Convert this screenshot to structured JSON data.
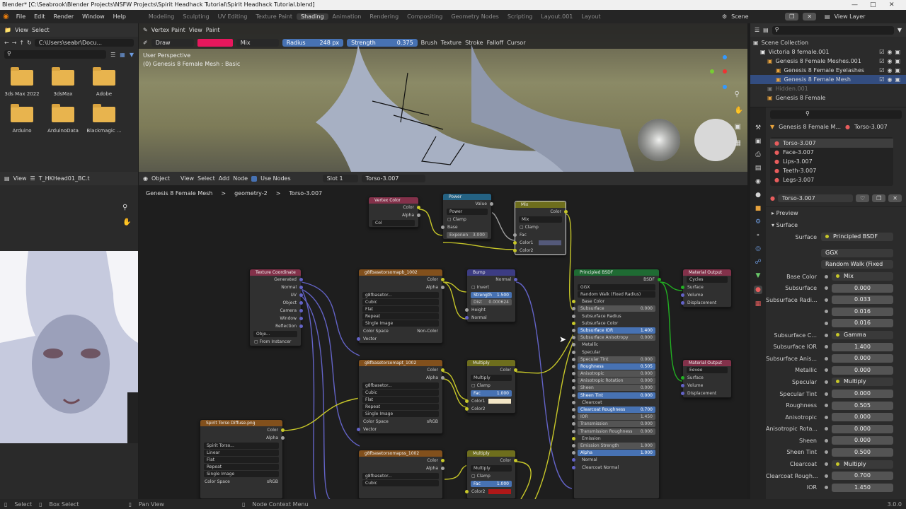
{
  "window": {
    "title": "Blender* [C:\\Seabrook\\Blender Projects\\NSFW Projects\\Spirit Headhack Tutorial\\Spirit Headhack Tutorial.blend]"
  },
  "menu": [
    "File",
    "Edit",
    "Render",
    "Window",
    "Help"
  ],
  "workspaces": [
    "Modeling",
    "Sculpting",
    "UV Editing",
    "Texture Paint",
    "Shading",
    "Animation",
    "Rendering",
    "Compositing",
    "Geometry Nodes",
    "Scripting",
    "Layout.001",
    "Layout"
  ],
  "active_workspace": "Shading",
  "scene": {
    "label": "Scene",
    "view_layer": "View Layer"
  },
  "file_browser": {
    "view": "View",
    "select": "Select",
    "path": "C:\\Users\\seabr\\Docu...",
    "folders": [
      "3ds Max 2022",
      "3dsMax",
      "Adobe",
      "Arduino",
      "ArduinoData",
      "Blackmagic ..."
    ]
  },
  "viewport": {
    "mode": "Vertex Paint",
    "view": "View",
    "paint": "Paint",
    "tool": "Draw",
    "blend": "Mix",
    "radius_label": "Radius",
    "radius_value": "248 px",
    "strength_label": "Strength",
    "strength_value": "0.375",
    "brush": "Brush",
    "texture": "Texture",
    "stroke": "Stroke",
    "falloff": "Falloff",
    "cursor": "Cursor",
    "overlay_line1": "User Perspective",
    "overlay_line2": "(0) Genesis 8 Female Mesh : Basic",
    "paint_color": "#e8175d"
  },
  "image_editor": {
    "view": "View",
    "image": "T_HKHead01_BC.t"
  },
  "node_editor": {
    "type": "Object",
    "view": "View",
    "select": "Select",
    "add": "Add",
    "node": "Node",
    "use_nodes": "Use Nodes",
    "slot": "Slot 1",
    "material": "Torso-3.007",
    "breadcrumb": [
      "Genesis 8 Female Mesh",
      "geometry-2",
      "Torso-3.007"
    ]
  },
  "nodes": {
    "vertex_color": {
      "title": "Vertex Color",
      "out1": "Color",
      "out2": "Alpha",
      "field": "Col"
    },
    "power": {
      "title": "Power",
      "out": "Value",
      "op": "Power",
      "clamp": "Clamp",
      "base": "Base",
      "exp_label": "Exponen",
      "exp_value": "3.000"
    },
    "mix": {
      "title": "Mix",
      "out": "Color",
      "op": "Mix",
      "clamp": "Clamp",
      "fac": "Fac",
      "c1": "Color1",
      "c2": "Color2"
    },
    "texcoord": {
      "title": "Texture Coordinate",
      "outs": [
        "Generated",
        "Normal",
        "UV",
        "Object",
        "Camera",
        "Window",
        "Reflection"
      ],
      "obj": "Obje...",
      "inst": "From Instancer"
    },
    "img1": {
      "title": "g8fbasetorsomapb_1002",
      "color": "Color",
      "alpha": "Alpha",
      "name": "g8fbasetor...",
      "interp": "Cubic",
      "proj": "Flat",
      "ext": "Repeat",
      "src": "Single Image",
      "cs_label": "Color Space",
      "cs_value": "Non-Color",
      "vec": "Vector"
    },
    "img2": {
      "title": "g8fbasetorsomapt_1002",
      "color": "Color",
      "alpha": "Alpha",
      "name": "g8fbasetor...",
      "interp": "Cubic",
      "proj": "Flat",
      "ext": "Repeat",
      "src": "Single Image",
      "cs_label": "Color Space",
      "cs_value": "sRGB",
      "vec": "Vector"
    },
    "img3": {
      "title": "g8fbasetorsomapss_1002",
      "color": "Color",
      "alpha": "Alpha",
      "name": "g8fbasetor...",
      "interp": "Cubic"
    },
    "img4": {
      "title": "Spirit Torso Diffuse.png",
      "color": "Color",
      "alpha": "Alpha",
      "name": "Spirit Torso...",
      "interp": "Linear",
      "proj": "Flat",
      "ext": "Repeat",
      "src": "Single Image",
      "cs_label": "Color Space",
      "cs_value": "sRGB"
    },
    "bump": {
      "title": "Bump",
      "out": "Normal",
      "invert": "Invert",
      "str_label": "Strength",
      "str_value": "1.500",
      "dist_label": "Dist",
      "dist_value": "0.000624",
      "height": "Height",
      "normal": "Normal"
    },
    "multiply1": {
      "title": "Multiply",
      "out": "Color",
      "op": "Multiply",
      "clamp": "Clamp",
      "fac_label": "Fac",
      "fac_value": "1.000",
      "c1": "Color1",
      "c2": "Color2"
    },
    "multiply2": {
      "title": "Multiply",
      "out": "Color",
      "op": "Multiply",
      "clamp": "Clamp",
      "fac_label": "Fac",
      "fac_value": "1.000",
      "c2": "Color2"
    },
    "bsdf": {
      "title": "Principled BSDF",
      "out": "BSDF",
      "dist": "GGX",
      "sss": "Random Walk (Fixed Radius)",
      "rows": [
        [
          "Base Color",
          ""
        ],
        [
          "Subsurface",
          "0.000"
        ],
        [
          "Subsurface Radius",
          ""
        ],
        [
          "Subsurface Color",
          ""
        ],
        [
          "Subsurface IOR",
          "1.400"
        ],
        [
          "Subsurface Anisotropy",
          "0.000"
        ],
        [
          "Metallic",
          ""
        ],
        [
          "Specular",
          ""
        ],
        [
          "Specular Tint",
          "0.000"
        ],
        [
          "Roughness",
          "0.505"
        ],
        [
          "Anisotropic",
          "0.000"
        ],
        [
          "Anisotropic Rotation",
          "0.000"
        ],
        [
          "Sheen",
          "0.000"
        ],
        [
          "Sheen Tint",
          "0.000"
        ],
        [
          "Clearcoat",
          ""
        ],
        [
          "Clearcoat Roughness",
          "0.700"
        ],
        [
          "IOR",
          "1.450"
        ],
        [
          "Transmission",
          "0.000"
        ],
        [
          "Transmission Roughness",
          "0.000"
        ],
        [
          "Emission",
          ""
        ],
        [
          "Emission Strength",
          "1.000"
        ],
        [
          "Alpha",
          "1.000"
        ],
        [
          "Normal",
          ""
        ],
        [
          "Clearcoat Normal",
          ""
        ]
      ]
    },
    "out1": {
      "title": "Material Output",
      "target": "Cycles",
      "ins": [
        "Surface",
        "Volume",
        "Displacement"
      ]
    },
    "out2": {
      "title": "Material Output",
      "target": "Eevee",
      "ins": [
        "Surface",
        "Volume",
        "Displacement"
      ]
    }
  },
  "outliner": {
    "items": [
      "Scene Collection",
      "Victoria 8 female.001",
      "Genesis 8 Female Meshes.001",
      "Genesis 8 Female Eyelashes",
      "Genesis 8 Female Mesh",
      "Hidden.001",
      "Genesis 8 Female"
    ]
  },
  "properties": {
    "object": "Genesis 8 Female M...",
    "material": "Torso-3.007",
    "slots": [
      "Torso-3.007",
      "Face-3.007",
      "Lips-3.007",
      "Teeth-3.007",
      "Legs-3.007"
    ],
    "mat_name": "Torso-3.007",
    "preview": "Preview",
    "surface_section": "Surface",
    "surface_label": "Surface",
    "surface_value": "Principled BSDF",
    "dist": "GGX",
    "sss": "Random Walk (Fixed R...",
    "rows": [
      {
        "label": "Base Color",
        "value": "Mix",
        "kind": "link"
      },
      {
        "label": "Subsurface",
        "value": "0.000",
        "kind": "num",
        "fill": 0
      },
      {
        "label": "Subsurface Radi...",
        "value": "0.033",
        "kind": "num",
        "fill": 0
      },
      {
        "label": "",
        "value": "0.016",
        "kind": "num",
        "fill": 0
      },
      {
        "label": "",
        "value": "0.016",
        "kind": "num",
        "fill": 0
      },
      {
        "label": "Subsurface C...",
        "value": "Gamma",
        "kind": "link"
      },
      {
        "label": "Subsurface IOR",
        "value": "1.400",
        "kind": "num",
        "fill": 0.05
      },
      {
        "label": "Subsurface Anis...",
        "value": "0.000",
        "kind": "num",
        "fill": 0
      },
      {
        "label": "Metallic",
        "value": "0.000",
        "kind": "num",
        "fill": 0
      },
      {
        "label": "Specular",
        "value": "Multiply",
        "kind": "link"
      },
      {
        "label": "Specular Tint",
        "value": "0.000",
        "kind": "num",
        "fill": 0
      },
      {
        "label": "Roughness",
        "value": "0.505",
        "kind": "num",
        "fill": 0.505
      },
      {
        "label": "Anisotropic",
        "value": "0.000",
        "kind": "num",
        "fill": 0
      },
      {
        "label": "Anisotropic Rota...",
        "value": "0.000",
        "kind": "num",
        "fill": 0
      },
      {
        "label": "Sheen",
        "value": "0.000",
        "kind": "num",
        "fill": 0
      },
      {
        "label": "Sheen Tint",
        "value": "0.500",
        "kind": "num",
        "fill": 0.5
      },
      {
        "label": "Clearcoat",
        "value": "Multiply",
        "kind": "link"
      },
      {
        "label": "Clearcoat Rough...",
        "value": "0.700",
        "kind": "num",
        "fill": 0.7
      },
      {
        "label": "IOR",
        "value": "1.450",
        "kind": "num",
        "fill": 0
      }
    ]
  },
  "statusbar": {
    "select": "Select",
    "box": "Box Select",
    "pan": "Pan View",
    "ctx": "Node Context Menu",
    "version": "3.0.0"
  }
}
